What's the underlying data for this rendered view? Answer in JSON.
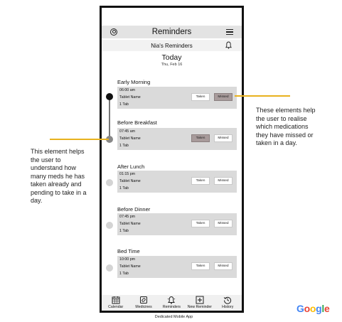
{
  "app": {
    "title": "Reminders",
    "subtitle": "Nia's Reminders",
    "today_title": "Today",
    "today_date": "Thu, Feb 16"
  },
  "sections": [
    {
      "title": "Early Morning",
      "time": "06:00 am",
      "tablet": "Tablet Name",
      "qty": "1 Tab",
      "taken_label": "Taken",
      "missed_label": "Missed",
      "state": "missed"
    },
    {
      "title": "Before Breakfast",
      "time": "07:45 am",
      "tablet": "Tablet Name",
      "qty": "1 Tab",
      "taken_label": "Taken",
      "missed_label": "Missed",
      "state": "taken"
    },
    {
      "title": "After Lunch",
      "time": "01:15 pm",
      "tablet": "Tablet Name",
      "qty": "1 Tab",
      "taken_label": "Taken",
      "missed_label": "Missed",
      "state": "pending"
    },
    {
      "title": "Before Dinner",
      "time": "07:45 pm",
      "tablet": "Tablet Name",
      "qty": "1 Tab",
      "taken_label": "Taken",
      "missed_label": "Missed",
      "state": "pending"
    },
    {
      "title": "Bed Time",
      "time": "10:00 pm",
      "tablet": "Tablet Name",
      "qty": "1 Tab",
      "taken_label": "Taken",
      "missed_label": "Missed",
      "state": "pending"
    }
  ],
  "nav": [
    {
      "label": "Calendar",
      "icon": "calendar-icon"
    },
    {
      "label": "Medicines",
      "icon": "medicines-icon"
    },
    {
      "label": "Reminders",
      "icon": "reminders-icon"
    },
    {
      "label": "New Reminder",
      "icon": "new-reminder-icon"
    },
    {
      "label": "History",
      "icon": "history-icon"
    }
  ],
  "caption": "Dedicated Mobile App",
  "annotations": {
    "left": "This element helps the user to understand how many meds he has taken already and pending to take in a day.",
    "right": "These elements help the user to realise which medications they have missed or taken in a day."
  },
  "brand": "Google",
  "colors": {
    "accent_line": "#e8b21e",
    "missed_active": "#a89b9b",
    "dot_done": "#111111",
    "dot_current": "#888888",
    "dot_pending": "#d4d4d4"
  }
}
